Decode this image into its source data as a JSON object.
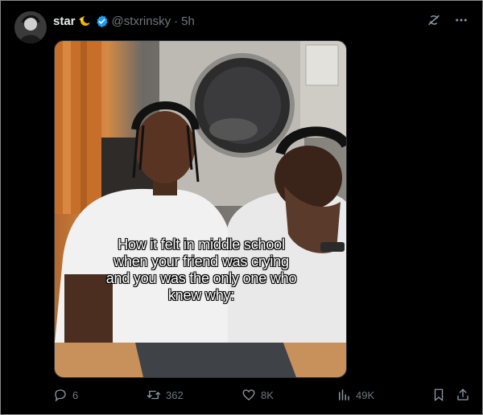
{
  "post": {
    "display_name": "star",
    "emoji_icon": "sparkle-moon-emoji",
    "verified": true,
    "handle": "@stxrinsky",
    "separator": "·",
    "time": "5h",
    "media_caption": "How it felt in middle school when your friend was crying and you was the only one who knew why:"
  },
  "top_icons": [
    "grok-icon",
    "more-icon"
  ],
  "actions": {
    "replies": "6",
    "reposts": "362",
    "likes": "8K",
    "views": "49K"
  },
  "colors": {
    "background": "#000000",
    "text": "#e7e9ea",
    "muted": "#71767b",
    "verified_blue": "#1d9bf0"
  }
}
